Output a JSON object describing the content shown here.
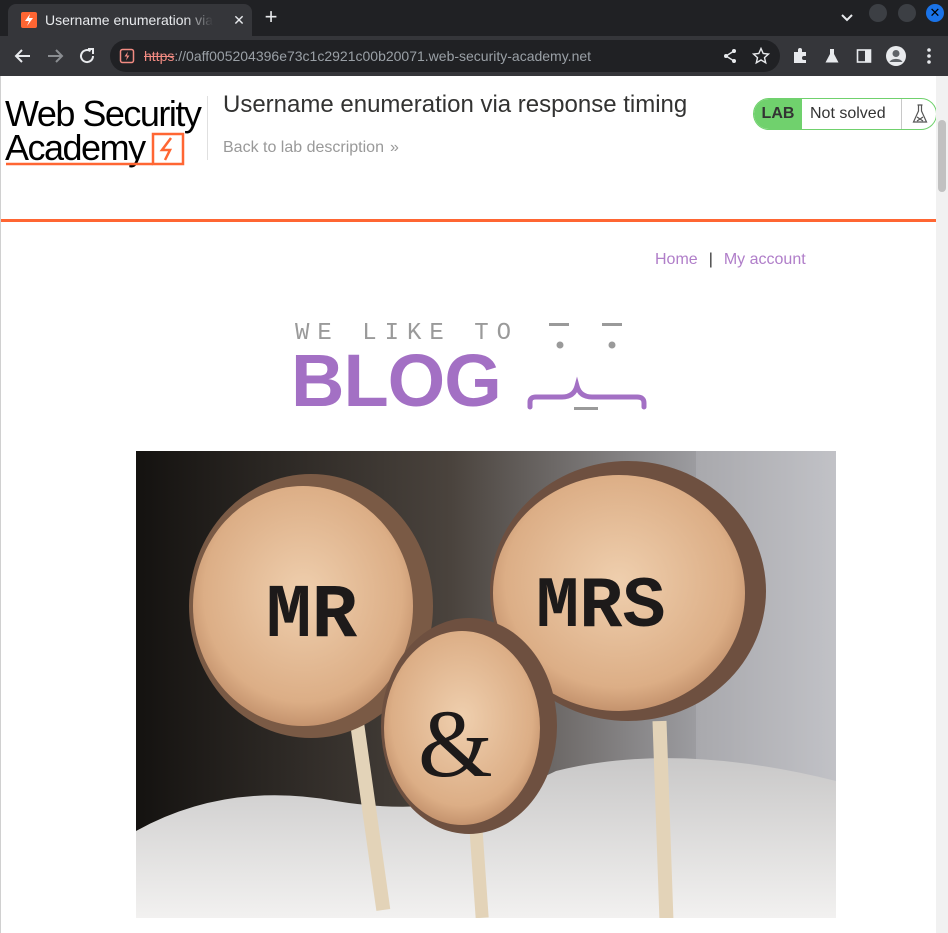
{
  "browser": {
    "tab_title": "Username enumeration via response timing",
    "url_scheme": "https",
    "url_rest": "://0aff005204396e73c1c2921c00b20071.web-security-academy.net"
  },
  "header": {
    "logo_line1": "Web Security",
    "logo_line2": "Academy",
    "lab_title": "Username enumeration via response timing",
    "back_link": "Back to lab description",
    "back_chevron": "»",
    "lab_badge": "LAB",
    "lab_status": "Not solved"
  },
  "nav": {
    "home": "Home",
    "separator": "|",
    "my_account": "My account"
  },
  "banner": {
    "we_like_to": "WE LIKE TO",
    "blog": "BLOG"
  },
  "hero_image": {
    "sign_mr": "MR",
    "sign_and": "&",
    "sign_mrs": "MRS"
  },
  "colors": {
    "accent_orange": "#ff6633",
    "lab_green": "#70d16d",
    "blog_purple": "#a370c4",
    "link_purple": "#b07ec9"
  }
}
